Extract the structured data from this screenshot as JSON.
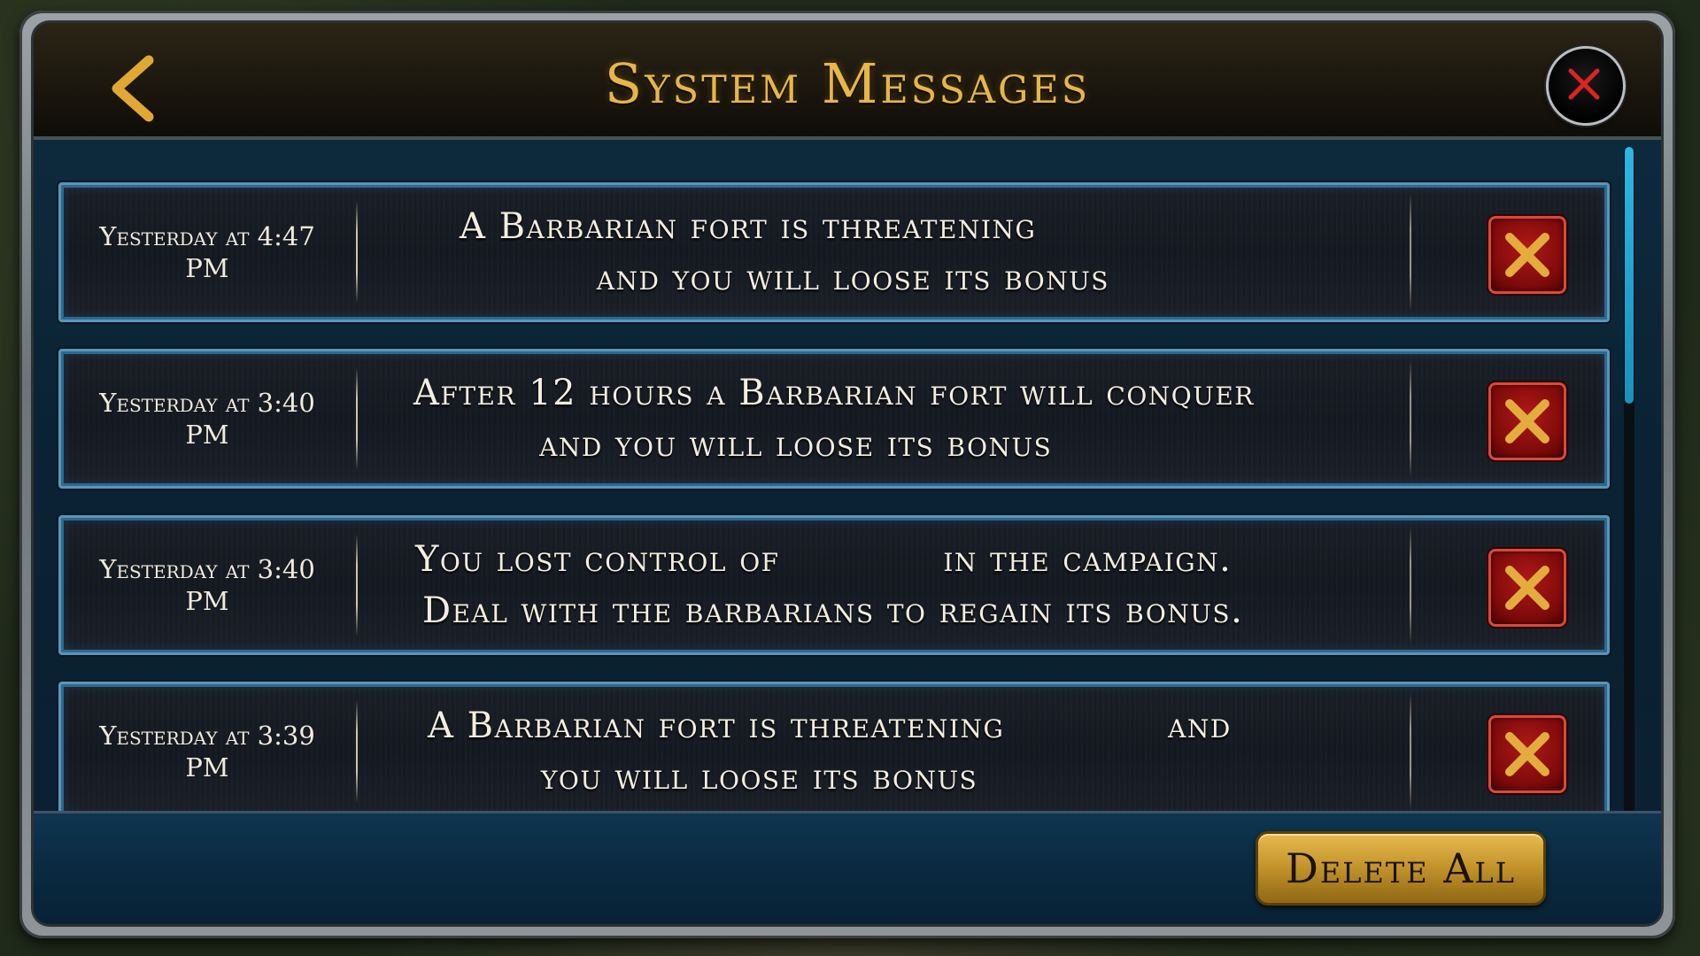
{
  "header": {
    "title": "System Messages"
  },
  "messages": [
    {
      "time": "Yesterday at 4:47 PM",
      "line1": "A Barbarian fort is threatening",
      "line2": "             and you will loose its bonus"
    },
    {
      "time": "Yesterday at 3:40 PM",
      "line1": "After 12 hours a Barbarian fort will conquer",
      "line2": "          and you will loose its bonus"
    },
    {
      "time": "Yesterday at 3:40 PM",
      "line1": "You lost control of             in the campaign.",
      "line2": "Deal with the barbarians to regain its bonus."
    },
    {
      "time": "Yesterday at 3:39 PM",
      "line1": "A Barbarian fort is threatening             and",
      "line2": "         you will loose its bonus"
    }
  ],
  "footer": {
    "delete_all_label": "Delete All"
  },
  "colors": {
    "title_gold": "#e7b648",
    "delete_red": "#b01818",
    "accent_blue": "#2fb6e4"
  },
  "icons": {
    "back": "chevron-left-icon",
    "close": "close-icon",
    "delete": "x-icon"
  }
}
